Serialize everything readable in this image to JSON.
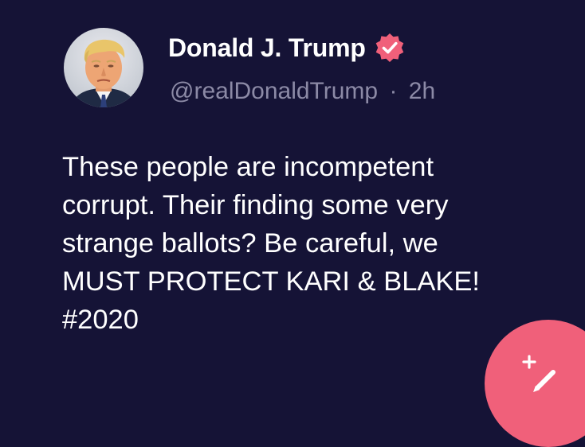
{
  "post": {
    "author": {
      "display_name": "Donald J. Trump",
      "handle": "@realDonaldTrump",
      "separator": "·",
      "time_ago": "2h",
      "verified": true
    },
    "body_lines": [
      "These people are incompetent",
      "corrupt. Their finding some very",
      "strange ballots? Be careful, we",
      "MUST PROTECT KARI & BLAKE!",
      "#2020"
    ]
  },
  "compose_button": {
    "icon": "compose-sparkle-pen-icon"
  },
  "colors": {
    "background": "#151336",
    "text_primary": "#ffffff",
    "text_secondary": "#8c8aa6",
    "accent": "#f0607a"
  }
}
